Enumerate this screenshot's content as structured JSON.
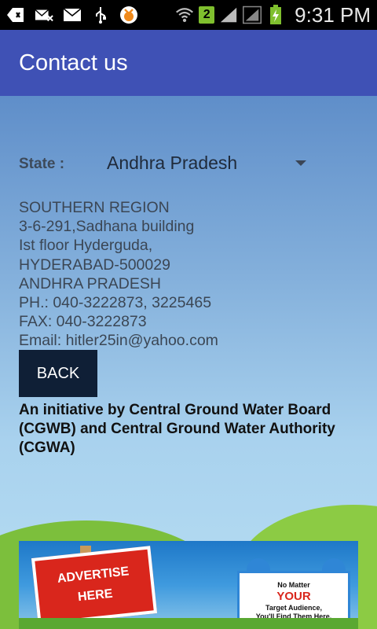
{
  "status_bar": {
    "time": "9:31 PM",
    "sim_badge": "2",
    "icons": [
      "add-notification-icon",
      "missed-mail-icon",
      "mail-icon",
      "usb-icon",
      "app-icon",
      "wifi-icon",
      "signal-icon",
      "battery-charging-icon"
    ]
  },
  "action_bar": {
    "title": "Contact us"
  },
  "state": {
    "label": "State :",
    "selected": "Andhra Pradesh"
  },
  "address": {
    "lines": [
      "SOUTHERN REGION",
      "3-6-291,Sadhana building",
      "Ist floor Hyderguda,",
      "HYDERABAD-500029",
      "ANDHRA PRADESH",
      "PH.: 040-3222873, 3225465",
      "FAX: 040-3222873",
      "Email: hitler25in@yahoo.com"
    ]
  },
  "back_button": {
    "label": "BACK"
  },
  "initiative": "An initiative by Central Ground Water Board (CGWB) and Central Ground Water Authority (CGWA)",
  "ad": {
    "sign_line1": "ADVERTISE",
    "sign_line2": "HERE",
    "board_line1": "No Matter",
    "board_line2": "YOUR",
    "board_line3": "Target Audience,",
    "board_line4": "You'll Find Them Here."
  },
  "colors": {
    "action_bar": "#3f51b5",
    "back_button": "#0f1f36",
    "ad_sign": "#d9261c"
  }
}
